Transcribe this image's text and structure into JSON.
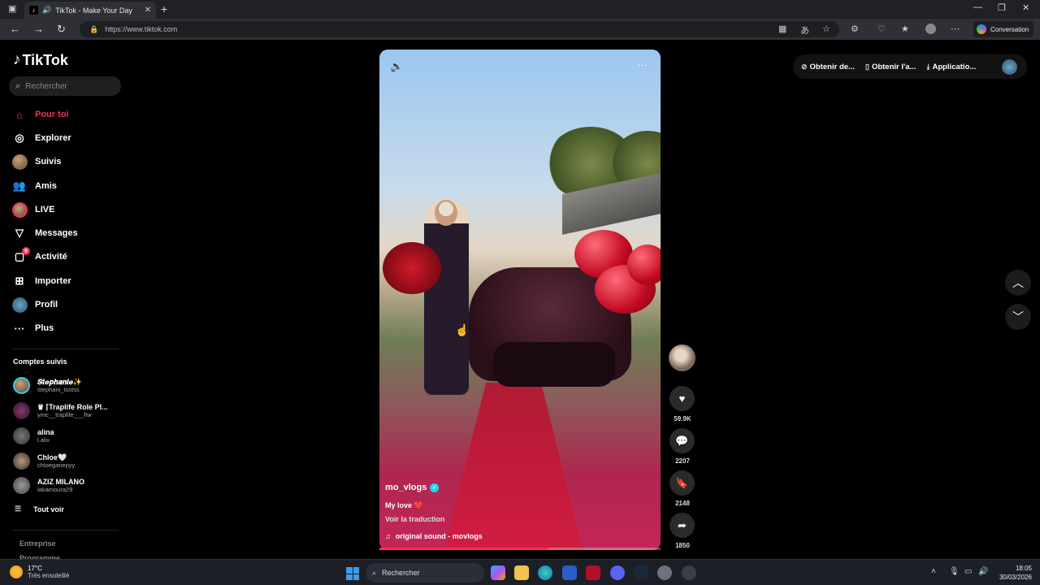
{
  "browser": {
    "tab_title": "TikTok - Make Your Day",
    "url": "https://www.tiktok.com",
    "conversation_label": "Conversation"
  },
  "sidebar": {
    "logo": "TikTok",
    "search_placeholder": "Rechercher",
    "nav": [
      {
        "label": "Pour toi",
        "icon": "home-icon",
        "active": true
      },
      {
        "label": "Explorer",
        "icon": "compass-icon"
      },
      {
        "label": "Suivis",
        "icon": "avatar-icon"
      },
      {
        "label": "Amis",
        "icon": "friends-icon"
      },
      {
        "label": "LIVE",
        "icon": "live-avatar-icon"
      },
      {
        "label": "Messages",
        "icon": "send-icon"
      },
      {
        "label": "Activité",
        "icon": "inbox-icon",
        "badge": "9"
      },
      {
        "label": "Importer",
        "icon": "plus-square-icon"
      },
      {
        "label": "Profil",
        "icon": "profile-avatar-icon"
      },
      {
        "label": "Plus",
        "icon": "more-dots-icon"
      }
    ],
    "following_title": "Comptes suivis",
    "accounts": [
      {
        "name": "𝑺𝒕𝒆𝒑𝒉𝒂𝒏𝒊𝒆✨",
        "handle": "stephani_tsstss"
      },
      {
        "name": "♛ ⌈Traplife Role Pl...",
        "handle": "ymc__traplife___ftw"
      },
      {
        "name": "alina",
        "handle": "l.alix"
      },
      {
        "name": "Chloe🤍",
        "handle": "chloegariepyy"
      },
      {
        "name": "AZIZ MILANO",
        "handle": "lakamoura29"
      }
    ],
    "see_all": "Tout voir",
    "footer": [
      "Entreprise",
      "Programme"
    ]
  },
  "video": {
    "username": "mo_vlogs",
    "description": "My love ❤️",
    "translate": "Voir la traduction",
    "sound": "original sound - movlogs",
    "progress": 0.6
  },
  "actions": {
    "likes": "59.9K",
    "comments": "2207",
    "saves": "2148",
    "shares": "1850"
  },
  "header": {
    "btn1": "Obtenir de...",
    "btn2": "Obtenir l'a...",
    "btn3": "Applicatio..."
  },
  "taskbar": {
    "temp": "17°C",
    "weather": "Très ensoleillé",
    "search": "Rechercher",
    "time": "18:05",
    "date": "30/03/2026"
  },
  "colors": {
    "accent": "#fe2c55",
    "verified": "#20d5ec"
  }
}
